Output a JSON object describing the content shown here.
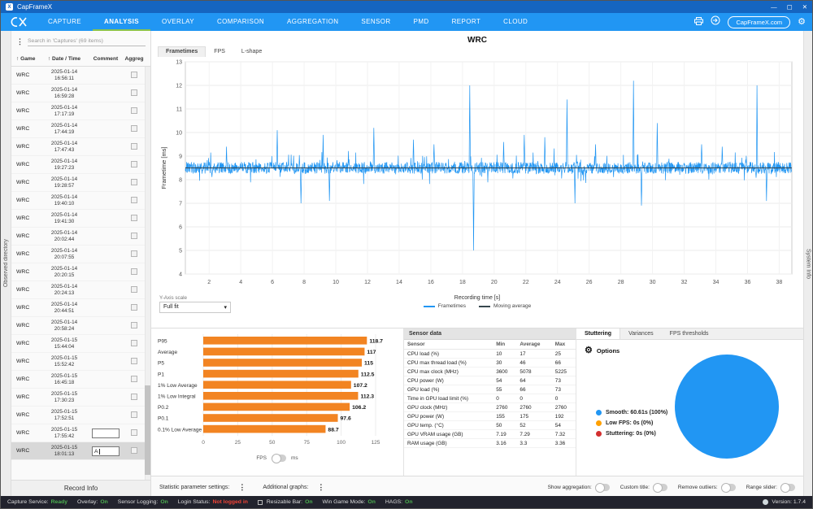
{
  "window": {
    "title": "CapFrameX"
  },
  "navbar": {
    "tabs": [
      {
        "label": "CAPTURE"
      },
      {
        "label": "ANALYSIS",
        "active": true
      },
      {
        "label": "OVERLAY"
      },
      {
        "label": "COMPARISON"
      },
      {
        "label": "AGGREGATION"
      },
      {
        "label": "SENSOR"
      },
      {
        "label": "PMD"
      },
      {
        "label": "REPORT"
      },
      {
        "label": "CLOUD"
      }
    ],
    "website_button": "CapFrameX.com"
  },
  "sidebar": {
    "observed_directory_label": "Observed directory",
    "search_placeholder": "Search in 'Captures' (69 items)",
    "columns": [
      "Game",
      "Date / Time",
      "Comment",
      "Aggreg"
    ],
    "selected_index": 21,
    "rows": [
      {
        "game": "WRC",
        "date": "2025-01-14",
        "time": "16:56:11"
      },
      {
        "game": "WRC",
        "date": "2025-01-14",
        "time": "16:59:28"
      },
      {
        "game": "WRC",
        "date": "2025-01-14",
        "time": "17:17:19"
      },
      {
        "game": "WRC",
        "date": "2025-01-14",
        "time": "17:44:19"
      },
      {
        "game": "WRC",
        "date": "2025-01-14",
        "time": "17:47:43"
      },
      {
        "game": "WRC",
        "date": "2025-01-14",
        "time": "19:27:23"
      },
      {
        "game": "WRC",
        "date": "2025-01-14",
        "time": "19:28:57"
      },
      {
        "game": "WRC",
        "date": "2025-01-14",
        "time": "19:40:10"
      },
      {
        "game": "WRC",
        "date": "2025-01-14",
        "time": "19:41:30"
      },
      {
        "game": "WRC",
        "date": "2025-01-14",
        "time": "20:02:44"
      },
      {
        "game": "WRC",
        "date": "2025-01-14",
        "time": "20:07:55"
      },
      {
        "game": "WRC",
        "date": "2025-01-14",
        "time": "20:20:15"
      },
      {
        "game": "WRC",
        "date": "2025-01-14",
        "time": "20:24:13"
      },
      {
        "game": "WRC",
        "date": "2025-01-14",
        "time": "20:44:51"
      },
      {
        "game": "WRC",
        "date": "2025-01-14",
        "time": "20:58:24"
      },
      {
        "game": "WRC",
        "date": "2025-01-15",
        "time": "15:44:04"
      },
      {
        "game": "WRC",
        "date": "2025-01-15",
        "time": "15:52:42"
      },
      {
        "game": "WRC",
        "date": "2025-01-15",
        "time": "16:45:18"
      },
      {
        "game": "WRC",
        "date": "2025-01-15",
        "time": "17:30:23"
      },
      {
        "game": "WRC",
        "date": "2025-01-15",
        "time": "17:52:51"
      },
      {
        "game": "WRC",
        "date": "2025-01-15",
        "time": "17:55:42",
        "comment_input": true,
        "comment": ""
      },
      {
        "game": "WRC",
        "date": "2025-01-15",
        "time": "18:01:13",
        "comment_input": true,
        "comment": "A"
      }
    ],
    "record_info_label": "Record Info"
  },
  "main": {
    "title": "WRC",
    "chart_tabs": [
      "Frametimes",
      "FPS",
      "L-shape"
    ],
    "active_chart_tab": "Frametimes",
    "yaxis_scale_label": "Y-Axis scale",
    "yaxis_scale_value": "Full fit",
    "system_info_label": "System Info"
  },
  "chart_data": [
    {
      "type": "line",
      "title": "WRC",
      "xlabel": "Recording time [s]",
      "ylabel": "Frametime [ms]",
      "xlim": [
        0.5,
        38.8
      ],
      "ylim": [
        4,
        13
      ],
      "xticks": [
        2,
        4,
        6,
        8,
        10,
        12,
        14,
        16,
        18,
        20,
        22,
        24,
        26,
        28,
        30,
        32,
        34,
        36,
        38
      ],
      "yticks": [
        4,
        5,
        6,
        7,
        8,
        9,
        10,
        11,
        12,
        13
      ],
      "grid": true,
      "legend_position": "bottom",
      "series": [
        {
          "name": "Frametimes",
          "color": "#2196F3",
          "baseline_ms": 8.5,
          "noise_band_ms": 0.5,
          "spikes": [
            {
              "x": 3.1,
              "y": 9.4
            },
            {
              "x": 6.3,
              "y": 10.1
            },
            {
              "x": 7.8,
              "y": 7.0
            },
            {
              "x": 9.2,
              "y": 9.9
            },
            {
              "x": 9.6,
              "y": 7.1
            },
            {
              "x": 12.4,
              "y": 10.2
            },
            {
              "x": 14.9,
              "y": 9.7
            },
            {
              "x": 16.2,
              "y": 9.5
            },
            {
              "x": 18.45,
              "y": 12.0
            },
            {
              "x": 18.7,
              "y": 5.0
            },
            {
              "x": 20.6,
              "y": 9.6
            },
            {
              "x": 21.9,
              "y": 9.9
            },
            {
              "x": 23.2,
              "y": 9.8
            },
            {
              "x": 24.6,
              "y": 11.4
            },
            {
              "x": 25.1,
              "y": 7.0
            },
            {
              "x": 26.4,
              "y": 9.5
            },
            {
              "x": 28.8,
              "y": 12.2
            },
            {
              "x": 29.3,
              "y": 6.9
            },
            {
              "x": 30.3,
              "y": 10.4
            },
            {
              "x": 33.1,
              "y": 9.5
            },
            {
              "x": 34.4,
              "y": 9.4
            },
            {
              "x": 36.6,
              "y": 12.0
            },
            {
              "x": 37.2,
              "y": 7.1
            }
          ]
        },
        {
          "name": "Moving average",
          "color": "#37474F",
          "value_ms": 8.5
        }
      ]
    },
    {
      "type": "bar",
      "orientation": "horizontal",
      "categories": [
        "P95",
        "Average",
        "P5",
        "P1",
        "1% Low Average",
        "1% Low Integral",
        "P0.2",
        "P0.1",
        "0.1% Low Average"
      ],
      "values": [
        118.7,
        117,
        115,
        112.5,
        107.2,
        112.3,
        106.2,
        97.6,
        88.7
      ],
      "xlabel": "FPS",
      "xlim": [
        0,
        125
      ],
      "xticks": [
        0,
        25,
        50,
        75,
        100,
        125
      ],
      "bar_color": "#F28422",
      "unit_toggle": {
        "left": "FPS",
        "right": "ms",
        "selected": "FPS"
      }
    },
    {
      "type": "pie",
      "slices": [
        {
          "label": "Smooth",
          "time": "60.61s",
          "percent": 100,
          "color": "#2196F3"
        },
        {
          "label": "Low FPS",
          "time": "0s",
          "percent": 0,
          "color": "#FFA000"
        },
        {
          "label": "Stuttering",
          "time": "0s",
          "percent": 0,
          "color": "#D32F2F"
        }
      ]
    }
  ],
  "sensor_panel": {
    "header": "Sensor data",
    "columns": [
      "Sensor",
      "Min",
      "Average",
      "Max"
    ],
    "rows": [
      [
        "CPU load (%)",
        "10",
        "17",
        "25"
      ],
      [
        "CPU max thread load (%)",
        "30",
        "46",
        "66"
      ],
      [
        "CPU max clock (MHz)",
        "3600",
        "5078",
        "5225"
      ],
      [
        "CPU power (W)",
        "54",
        "64",
        "73"
      ],
      [
        "GPU load (%)",
        "55",
        "66",
        "73"
      ],
      [
        "Time in GPU load limit (%)",
        "0",
        "0",
        "0"
      ],
      [
        "GPU clock (MHz)",
        "2760",
        "2760",
        "2760"
      ],
      [
        "GPU power (W)",
        "155",
        "175",
        "192"
      ],
      [
        "GPU temp. (°C)",
        "50",
        "52",
        "54"
      ],
      [
        "GPU VRAM usage (GB)",
        "7.19",
        "7.29",
        "7.32"
      ],
      [
        "RAM usage (GB)",
        "3.16",
        "3.3",
        "3.36"
      ]
    ]
  },
  "stutter_panel": {
    "tabs": [
      "Stuttering",
      "Variances",
      "FPS thresholds"
    ],
    "active_tab": "Stuttering",
    "options_label": "Options",
    "legend": [
      {
        "label": "Smooth:",
        "value": "60.61s (100%)",
        "color": "#2196F3"
      },
      {
        "label": "Low FPS:",
        "value": "0s (0%)",
        "color": "#FFA000"
      },
      {
        "label": "Stuttering:",
        "value": "0s (0%)",
        "color": "#D32F2F"
      }
    ]
  },
  "settings_row": {
    "statistic_label": "Statistic parameter settings:",
    "additional_label": "Additional graphs:",
    "toggles": [
      {
        "label": "Show aggregation:"
      },
      {
        "label": "Custom title:"
      },
      {
        "label": "Remove outliers:"
      },
      {
        "label": "Range slider:"
      }
    ]
  },
  "statusbar": {
    "items": [
      {
        "label": "Capture Service:",
        "value": "Ready",
        "color": "#4CAF50"
      },
      {
        "label": "Overlay:",
        "value": "On",
        "color": "#4CAF50"
      },
      {
        "label": "Sensor Logging:",
        "value": "On",
        "color": "#4CAF50"
      },
      {
        "label": "Login Status:",
        "value": "Not logged in",
        "color": "#F44336"
      },
      {
        "label": "Resizable Bar:",
        "value": "On",
        "color": "#4CAF50",
        "icon": true
      },
      {
        "label": "Win Game Mode:",
        "value": "On",
        "color": "#4CAF50"
      },
      {
        "label": "HAGS:",
        "value": "On",
        "color": "#4CAF50"
      }
    ],
    "version": "Version: 1.7.4"
  }
}
